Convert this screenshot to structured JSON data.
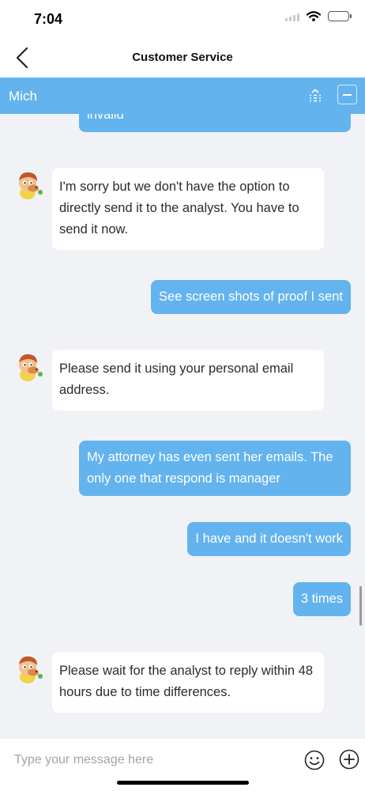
{
  "status_bar": {
    "time": "7:04"
  },
  "nav": {
    "title": "Customer Service"
  },
  "agent_bar": {
    "name": "Mich"
  },
  "messages": [
    {
      "from": "user",
      "text": "invalid"
    },
    {
      "from": "agent",
      "text": "I'm sorry but we don't have the option to directly send it to the analyst. You have to send it now."
    },
    {
      "from": "user",
      "text": "See screen shots of proof I sent"
    },
    {
      "from": "agent",
      "text": "Please send it using your personal email address."
    },
    {
      "from": "user",
      "text": "My attorney has even sent her emails. The only one that respond is manager"
    },
    {
      "from": "user",
      "text": "I have and it doesn't work"
    },
    {
      "from": "user",
      "text": "3 times"
    },
    {
      "from": "agent",
      "text": "Please wait for the analyst to reply within 48 hours due to time differences."
    }
  ],
  "composer": {
    "placeholder": "Type your message here"
  },
  "colors": {
    "accent": "#63b3ee",
    "background": "#f1f2f6"
  },
  "icons": {
    "back": "chevron-left-icon",
    "expand": "expand-icon",
    "minimize": "minimize-icon",
    "emoji": "smiley-icon",
    "add": "plus-circle-icon",
    "avatar": "mascot-avatar"
  }
}
